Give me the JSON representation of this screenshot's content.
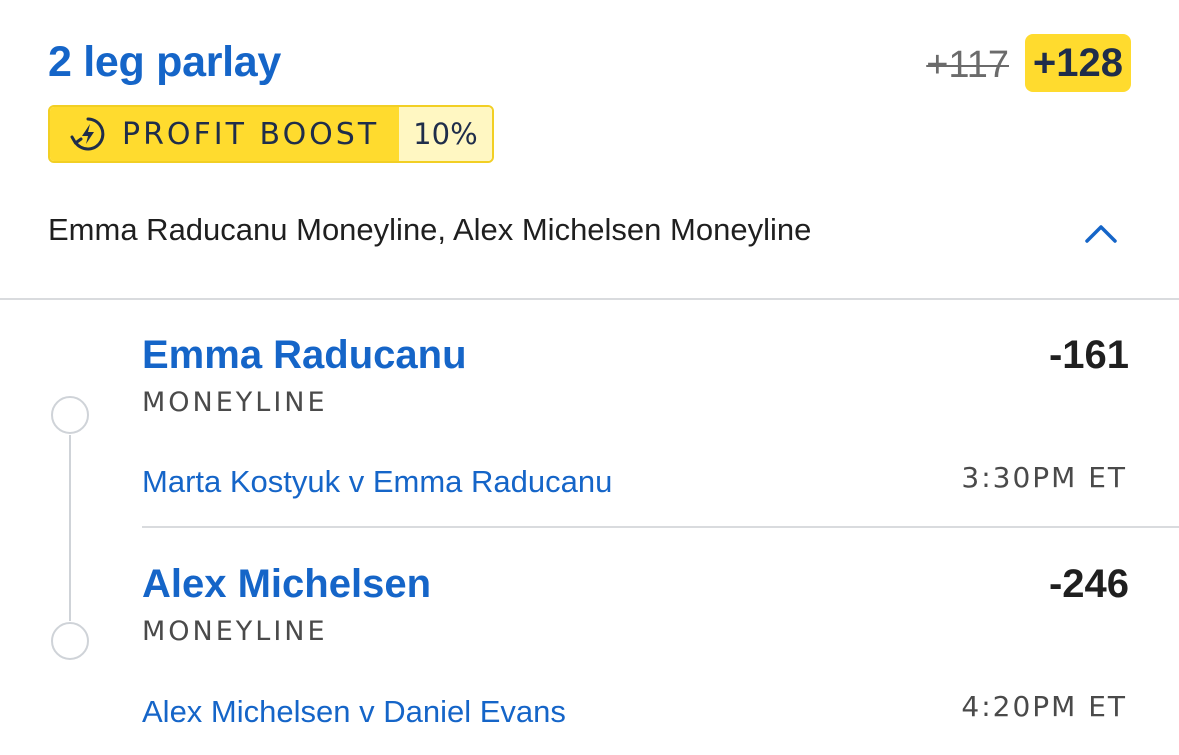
{
  "header": {
    "title": "2 leg parlay",
    "original_odds": "+117",
    "boosted_odds": "+128"
  },
  "boost": {
    "label": "PROFIT BOOST",
    "percent": "10%",
    "icon": "lightning-clock-icon",
    "colors": {
      "badge": "#ffdb2e",
      "percent_bg": "#fff7c2"
    }
  },
  "summary": {
    "text": "Emma Raducanu Moneyline, Alex Michelsen Moneyline",
    "toggle_icon": "chevron-up-icon"
  },
  "legs": [
    {
      "selection": "Emma Raducanu",
      "market": "MONEYLINE",
      "odds": "-161",
      "event": "Marta Kostyuk v Emma Raducanu",
      "time": "3:30PM ET"
    },
    {
      "selection": "Alex Michelsen",
      "market": "MONEYLINE",
      "odds": "-246",
      "event": "Alex Michelsen v Daniel Evans",
      "time": "4:20PM ET"
    }
  ],
  "colors": {
    "accent": "#1565c8",
    "highlight": "#ffdb2e"
  }
}
